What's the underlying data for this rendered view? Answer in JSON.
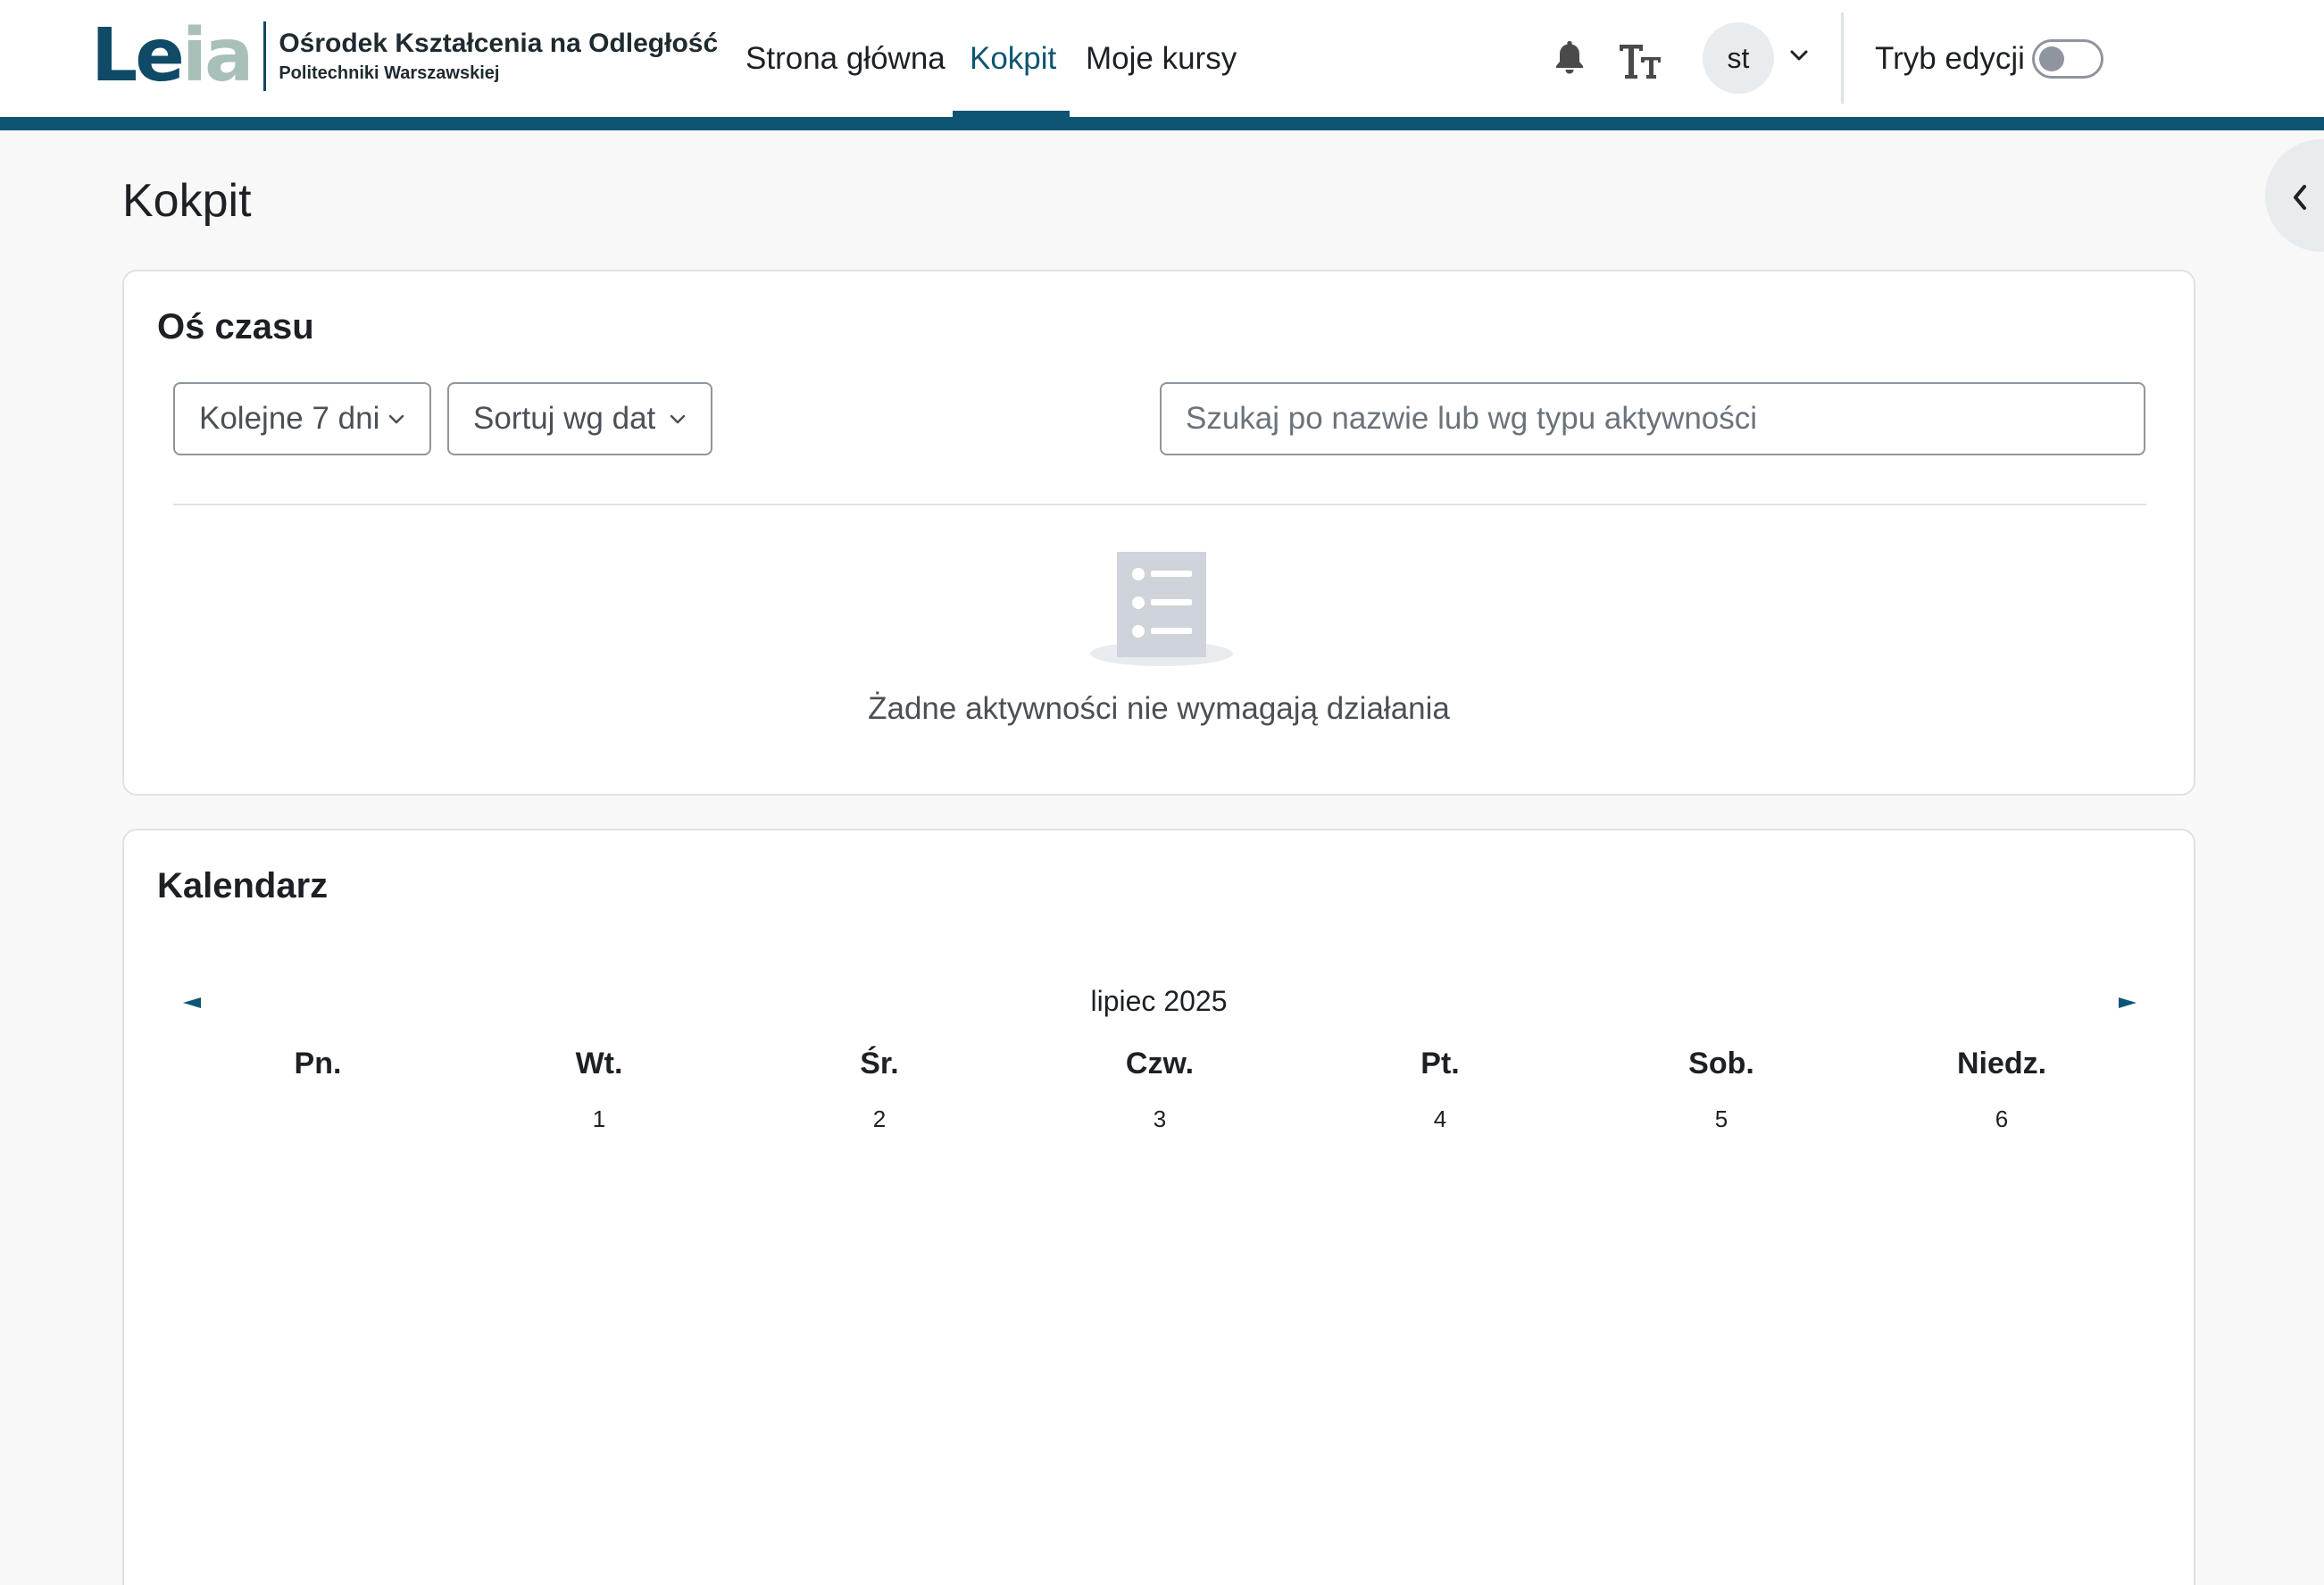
{
  "brand": {
    "logo_left": "Le",
    "logo_right": "ia",
    "title": "Ośrodek Kształcenia na Odległość",
    "subtitle": "Politechniki Warszawskiej"
  },
  "nav": {
    "items": [
      {
        "label": "Strona główna",
        "active": false
      },
      {
        "label": "Kokpit",
        "active": true
      },
      {
        "label": "Moje kursy",
        "active": false
      }
    ],
    "user_initials": "st",
    "edit_mode_label": "Tryb edycji",
    "edit_mode_on": false
  },
  "colors": {
    "brand": "#0d5572",
    "logo_accent": "#a9bfb9",
    "background": "#f8f8f8"
  },
  "page": {
    "title": "Kokpit"
  },
  "timeline": {
    "title": "Oś czasu",
    "range_select": "Kolejne 7 dni",
    "sort_select": "Sortuj wg dat",
    "search_placeholder": "Szukaj po nazwie lub wg typu aktywności",
    "empty_message": "Żadne aktywności nie wymagają działania"
  },
  "calendar": {
    "title": "Kalendarz",
    "month": "lipiec 2025",
    "prev_icon": "◄",
    "next_icon": "►",
    "weekdays": [
      "Pn.",
      "Wt.",
      "Śr.",
      "Czw.",
      "Pt.",
      "Sob.",
      "Niedz."
    ],
    "first_week": [
      "",
      "1",
      "2",
      "3",
      "4",
      "5",
      "6"
    ]
  }
}
